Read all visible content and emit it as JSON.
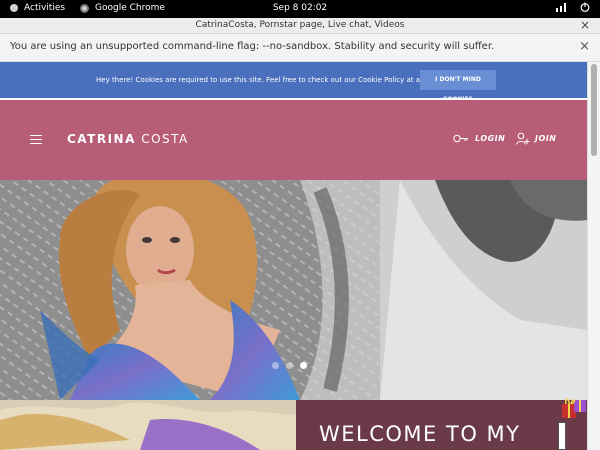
{
  "topbar": {
    "activities": "Activities",
    "app_name": "Google Chrome",
    "clock": "Sep 8  02:02"
  },
  "window": {
    "title": "CatrinaCosta, Pornstar page, Live chat, Videos",
    "close": "×"
  },
  "flag_bar": {
    "message": "You are using an unsupported command-line flag: --no-sandbox. Stability and security will suffer.",
    "close": "×"
  },
  "cookie": {
    "text": "Hey there! Cookies are required to use this site. Feel free to check out our Cookie Policy at any time.",
    "button": "I DON'T MIND COOKIES"
  },
  "header": {
    "brand_first": "CATRINA",
    "brand_last": " COSTA",
    "login": "LOGIN",
    "join": "JOIN"
  },
  "hero": {
    "slides": 3,
    "active_slide": 3
  },
  "welcome": {
    "heading": "WELCOME TO MY"
  },
  "colors": {
    "cookie_bg": "#4a6fbd",
    "header_bg": "#b85d78",
    "welcome_bg": "#6a3a48"
  }
}
